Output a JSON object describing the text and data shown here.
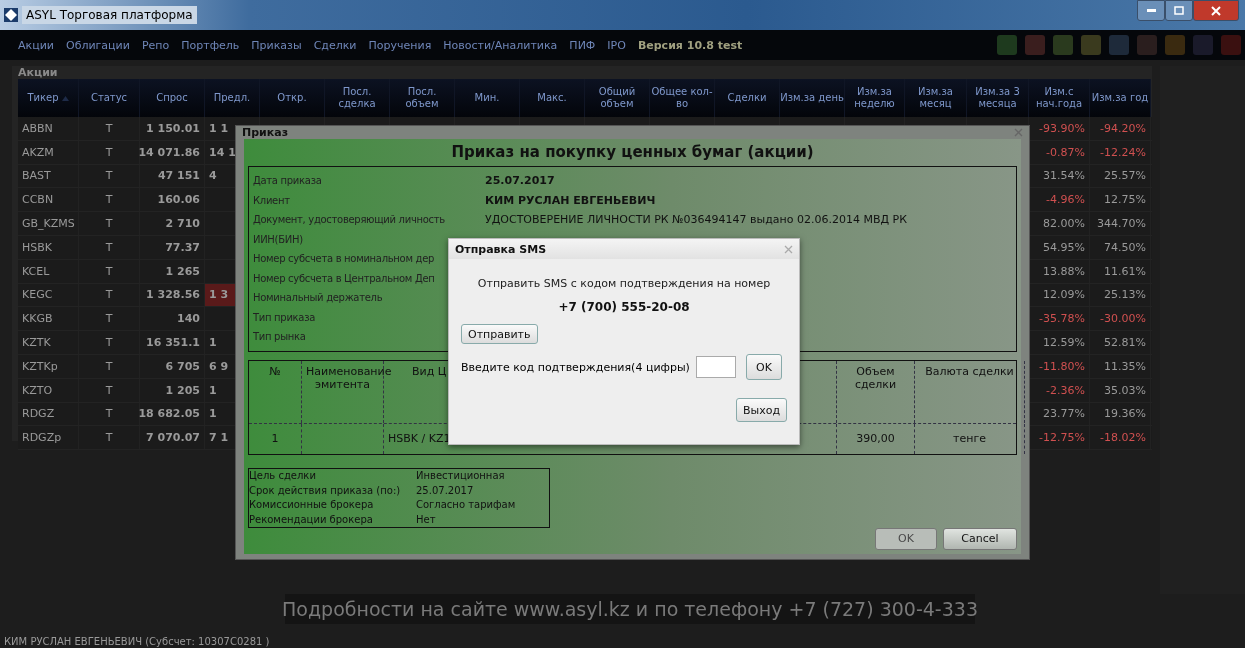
{
  "window": {
    "title": "ASYL Торговая платформа"
  },
  "menu": {
    "items": [
      "Акции",
      "Облигации",
      "Репо",
      "Портфель",
      "Приказы",
      "Сделки",
      "Поручения",
      "Новости/Аналитика",
      "ПИФ",
      "IPO"
    ],
    "version": "Версия 10.8 test"
  },
  "panel": {
    "title": "Акции",
    "columns": [
      {
        "label": "Тикер",
        "sorted": true
      },
      {
        "label": "Статус",
        "sorted": false
      },
      {
        "label": "Спрос",
        "sorted": false
      },
      {
        "label": "Предл.",
        "sorted": false
      },
      {
        "label": "Откр.",
        "sorted": false
      },
      {
        "label": "Посл. сделка",
        "sorted": false
      },
      {
        "label": "Посл. объем",
        "sorted": false
      },
      {
        "label": "Мин.",
        "sorted": false
      },
      {
        "label": "Макс.",
        "sorted": false
      },
      {
        "label": "Общий объем",
        "sorted": false
      },
      {
        "label": "Общее кол-во",
        "sorted": false
      },
      {
        "label": "Сделки",
        "sorted": false
      },
      {
        "label": "Изм.за день",
        "sorted": false
      },
      {
        "label": "Изм.за неделю",
        "sorted": false
      },
      {
        "label": "Изм.за месяц",
        "sorted": false
      },
      {
        "label": "Изм.за 3 месяца",
        "sorted": false
      },
      {
        "label": "Изм.с нач.года",
        "sorted": false
      },
      {
        "label": "Изм.за год",
        "sorted": false
      }
    ],
    "rows": [
      {
        "ticker": "ABBN",
        "status": "T",
        "bid": "1 150.01",
        "ask": "1 1",
        "ask_highlight": false,
        "ytd": {
          "text": "-93.90%",
          "negative": true
        },
        "year": {
          "text": "-94.20%",
          "negative": true
        }
      },
      {
        "ticker": "AKZM",
        "status": "T",
        "bid": "14 071.86",
        "ask": "14 1",
        "ask_highlight": false,
        "ytd": {
          "text": "-0.87%",
          "negative": true
        },
        "year": {
          "text": "-12.24%",
          "negative": true
        }
      },
      {
        "ticker": "BAST",
        "status": "T",
        "bid": "47 151",
        "ask": "4",
        "ask_highlight": false,
        "ytd": {
          "text": "31.54%",
          "negative": false
        },
        "year": {
          "text": "25.57%",
          "negative": false
        }
      },
      {
        "ticker": "CCBN",
        "status": "T",
        "bid": "160.06",
        "ask_highlight": false,
        "ytd": {
          "text": "-4.96%",
          "negative": true
        },
        "year": {
          "text": "12.75%",
          "negative": false
        }
      },
      {
        "ticker": "GB_KZMS",
        "status": "T",
        "bid": "2 710",
        "ask_highlight": false,
        "ytd": {
          "text": "82.00%",
          "negative": false
        },
        "year": {
          "text": "344.70%",
          "negative": false
        }
      },
      {
        "ticker": "HSBK",
        "status": "T",
        "bid": "77.37",
        "ask_highlight": false,
        "ytd": {
          "text": "54.95%",
          "negative": false
        },
        "year": {
          "text": "74.50%",
          "negative": false
        }
      },
      {
        "ticker": "KCEL",
        "status": "T",
        "bid": "1 265",
        "ask_highlight": false,
        "ytd": {
          "text": "13.88%",
          "negative": false
        },
        "year": {
          "text": "11.61%",
          "negative": false
        }
      },
      {
        "ticker": "KEGC",
        "status": "T",
        "bid": "1 328.56",
        "ask": "1 3",
        "ask_highlight": true,
        "ytd": {
          "text": "12.09%",
          "negative": false
        },
        "year": {
          "text": "25.13%",
          "negative": false
        }
      },
      {
        "ticker": "KKGB",
        "status": "T",
        "bid": "140",
        "ask_highlight": false,
        "ytd": {
          "text": "-35.78%",
          "negative": true
        },
        "year": {
          "text": "-30.00%",
          "negative": true
        }
      },
      {
        "ticker": "KZTK",
        "status": "T",
        "bid": "16 351.1",
        "ask": "1",
        "ask_highlight": false,
        "ytd": {
          "text": "12.59%",
          "negative": false
        },
        "year": {
          "text": "52.81%",
          "negative": false
        }
      },
      {
        "ticker": "KZTKp",
        "status": "T",
        "bid": "6 705",
        "ask": "6 9",
        "ask_highlight": false,
        "ytd": {
          "text": "-11.80%",
          "negative": true
        },
        "year": {
          "text": "11.35%",
          "negative": false
        }
      },
      {
        "ticker": "KZTO",
        "status": "T",
        "bid": "1 205",
        "ask": "1",
        "ask_highlight": false,
        "ytd": {
          "text": "-2.36%",
          "negative": true
        },
        "year": {
          "text": "35.03%",
          "negative": false
        }
      },
      {
        "ticker": "RDGZ",
        "status": "T",
        "bid": "18 682.05",
        "ask": "1",
        "ask_highlight": false,
        "ytd": {
          "text": "23.77%",
          "negative": false
        },
        "year": {
          "text": "19.36%",
          "negative": false
        }
      },
      {
        "ticker": "RDGZp",
        "status": "T",
        "bid": "7 070.07",
        "ask": "7 1",
        "ask_highlight": false,
        "ytd": {
          "text": "-12.75%",
          "negative": true
        },
        "year": {
          "text": "-18.02%",
          "negative": true
        }
      }
    ]
  },
  "order_dialog": {
    "title": "Приказ",
    "heading": "Приказ на покупку ценных бумаг (акции)",
    "fields": [
      {
        "label": "Дата приказа",
        "value": "25.07.2017",
        "bold": true
      },
      {
        "label": "Клиент",
        "value": "КИМ РУСЛАН ЕВГЕНЬЕВИЧ",
        "bold": true
      },
      {
        "label": "Документ, удостоверяющий личность",
        "value": "УДОСТОВЕРЕНИЕ ЛИЧНОСТИ РК №036494147 выдано 02.06.2014 МВД РК",
        "bold": false
      },
      {
        "label": "ИИН(БИН)"
      },
      {
        "label": "Номер субсчета в номинальном дер"
      },
      {
        "label": "Номер субсчета в Центральном Деп"
      },
      {
        "label": "Номинальный держатель"
      },
      {
        "label": "Тип приказа"
      },
      {
        "label": "Тип рынка"
      }
    ],
    "items_table": {
      "columns": [
        "№",
        "Наименование эмитента",
        "Вид Ц",
        "Объем сделки",
        "Валюта сделки"
      ],
      "rows": [
        [
          "1",
          "",
          "HSBK / KZ1",
          "390,00",
          "тенге"
        ]
      ]
    },
    "terms": [
      {
        "label": "Цель сделки",
        "value": "Инвестиционная"
      },
      {
        "label": "Срок действия приказа (по:)",
        "value": "25.07.2017"
      },
      {
        "label": "Комиссионные брокера",
        "value": "Согласно тарифам"
      },
      {
        "label": "Рекомендации брокера",
        "value": "Нет"
      }
    ],
    "buttons": [
      {
        "label": "OK",
        "disabled": true
      },
      {
        "label": "Cancel",
        "disabled": false
      }
    ]
  },
  "sms_dialog": {
    "title": "Отправка SMS",
    "prompt": "Отправить SMS с кодом подтверждения на номер",
    "phone": "+7 (700) 555-20-08",
    "send_button": "Отправить",
    "code_label": "Введите код подтверждения(4 цифры)",
    "ok_button": "OK",
    "exit_button": "Выход"
  },
  "banner": "Подробности на сайте www.asyl.kz и по телефону +7 (727) 300-4-333",
  "status_bar": "КИМ РУСЛАН ЕВГЕНЬЕВИЧ (Субсчет: 10307C0281 )"
}
